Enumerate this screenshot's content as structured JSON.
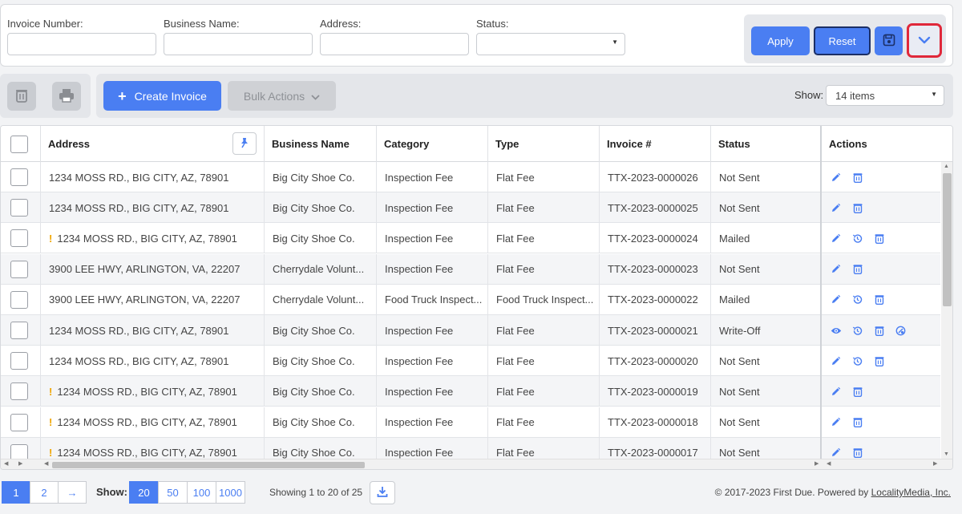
{
  "filters": {
    "invoice_number_label": "Invoice Number:",
    "business_name_label": "Business Name:",
    "address_label": "Address:",
    "status_label": "Status:",
    "invoice_number_value": "",
    "business_name_value": "",
    "address_value": "",
    "status_value": "",
    "apply_label": "Apply",
    "reset_label": "Reset",
    "save_icon": "save-icon",
    "expand_icon": "chevron-down-icon"
  },
  "toolbar": {
    "delete_icon": "trash-icon",
    "print_icon": "printer-icon",
    "create_label": "Create Invoice",
    "bulk_label": "Bulk Actions",
    "show_label": "Show:",
    "show_value": "14 items"
  },
  "table": {
    "headers": {
      "address": "Address",
      "business_name": "Business Name",
      "category": "Category",
      "type": "Type",
      "invoice": "Invoice #",
      "status": "Status",
      "actions": "Actions"
    },
    "rows": [
      {
        "warn": "",
        "address": "1234 MOSS RD., BIG CITY, AZ, 78901",
        "business": "Big City Shoe Co.",
        "category": "Inspection Fee",
        "type": "Flat Fee",
        "invoice": "TTX-2023-0000026",
        "status": "Not Sent",
        "actions": [
          "edit",
          "delete"
        ]
      },
      {
        "warn": "",
        "address": "1234 MOSS RD., BIG CITY, AZ, 78901",
        "business": "Big City Shoe Co.",
        "category": "Inspection Fee",
        "type": "Flat Fee",
        "invoice": "TTX-2023-0000025",
        "status": "Not Sent",
        "actions": [
          "edit",
          "delete"
        ]
      },
      {
        "warn": "!",
        "address": "1234 MOSS RD., BIG CITY, AZ, 78901",
        "business": "Big City Shoe Co.",
        "category": "Inspection Fee",
        "type": "Flat Fee",
        "invoice": "TTX-2023-0000024",
        "status": "Mailed",
        "actions": [
          "edit",
          "history",
          "delete"
        ]
      },
      {
        "warn": "",
        "address": "3900 LEE HWY, ARLINGTON, VA, 22207",
        "business": "Cherrydale Volunt...",
        "category": "Inspection Fee",
        "type": "Flat Fee",
        "invoice": "TTX-2023-0000023",
        "status": "Not Sent",
        "actions": [
          "edit",
          "delete"
        ]
      },
      {
        "warn": "",
        "address": "3900 LEE HWY, ARLINGTON, VA, 22207",
        "business": "Cherrydale Volunt...",
        "category": "Food Truck Inspect...",
        "type": "Food Truck Inspect...",
        "invoice": "TTX-2023-0000022",
        "status": "Mailed",
        "actions": [
          "edit",
          "history",
          "delete"
        ]
      },
      {
        "warn": "",
        "address": "1234 MOSS RD., BIG CITY, AZ, 78901",
        "business": "Big City Shoe Co.",
        "category": "Inspection Fee",
        "type": "Flat Fee",
        "invoice": "TTX-2023-0000021",
        "status": "Write-Off",
        "actions": [
          "view",
          "history",
          "delete",
          "reverse"
        ]
      },
      {
        "warn": "",
        "address": "1234 MOSS RD., BIG CITY, AZ, 78901",
        "business": "Big City Shoe Co.",
        "category": "Inspection Fee",
        "type": "Flat Fee",
        "invoice": "TTX-2023-0000020",
        "status": "Not Sent",
        "actions": [
          "edit",
          "history",
          "delete"
        ]
      },
      {
        "warn": "!",
        "address": "1234 MOSS RD., BIG CITY, AZ, 78901",
        "business": "Big City Shoe Co.",
        "category": "Inspection Fee",
        "type": "Flat Fee",
        "invoice": "TTX-2023-0000019",
        "status": "Not Sent",
        "actions": [
          "edit",
          "delete"
        ]
      },
      {
        "warn": "!",
        "address": "1234 MOSS RD., BIG CITY, AZ, 78901",
        "business": "Big City Shoe Co.",
        "category": "Inspection Fee",
        "type": "Flat Fee",
        "invoice": "TTX-2023-0000018",
        "status": "Not Sent",
        "actions": [
          "edit",
          "delete"
        ]
      },
      {
        "warn": "!",
        "address": "1234 MOSS RD., BIG CITY, AZ, 78901",
        "business": "Big City Shoe Co.",
        "category": "Inspection Fee",
        "type": "Flat Fee",
        "invoice": "TTX-2023-0000017",
        "status": "Not Sent",
        "actions": [
          "edit",
          "delete"
        ]
      }
    ]
  },
  "footer": {
    "pages": [
      "1",
      "2",
      "→"
    ],
    "active_page": "1",
    "show_label": "Show:",
    "page_sizes": [
      "20",
      "50",
      "100",
      "1000"
    ],
    "active_size": "20",
    "showing_text": "Showing 1 to 20 of 25",
    "download_icon": "download-icon",
    "copyright_text": "© 2017-2023 First Due. Powered by ",
    "copyright_link": "LocalityMedia, Inc."
  },
  "colors": {
    "primary": "#4a7ef2",
    "highlight_border": "#e0283a",
    "warning": "#f0a500"
  }
}
